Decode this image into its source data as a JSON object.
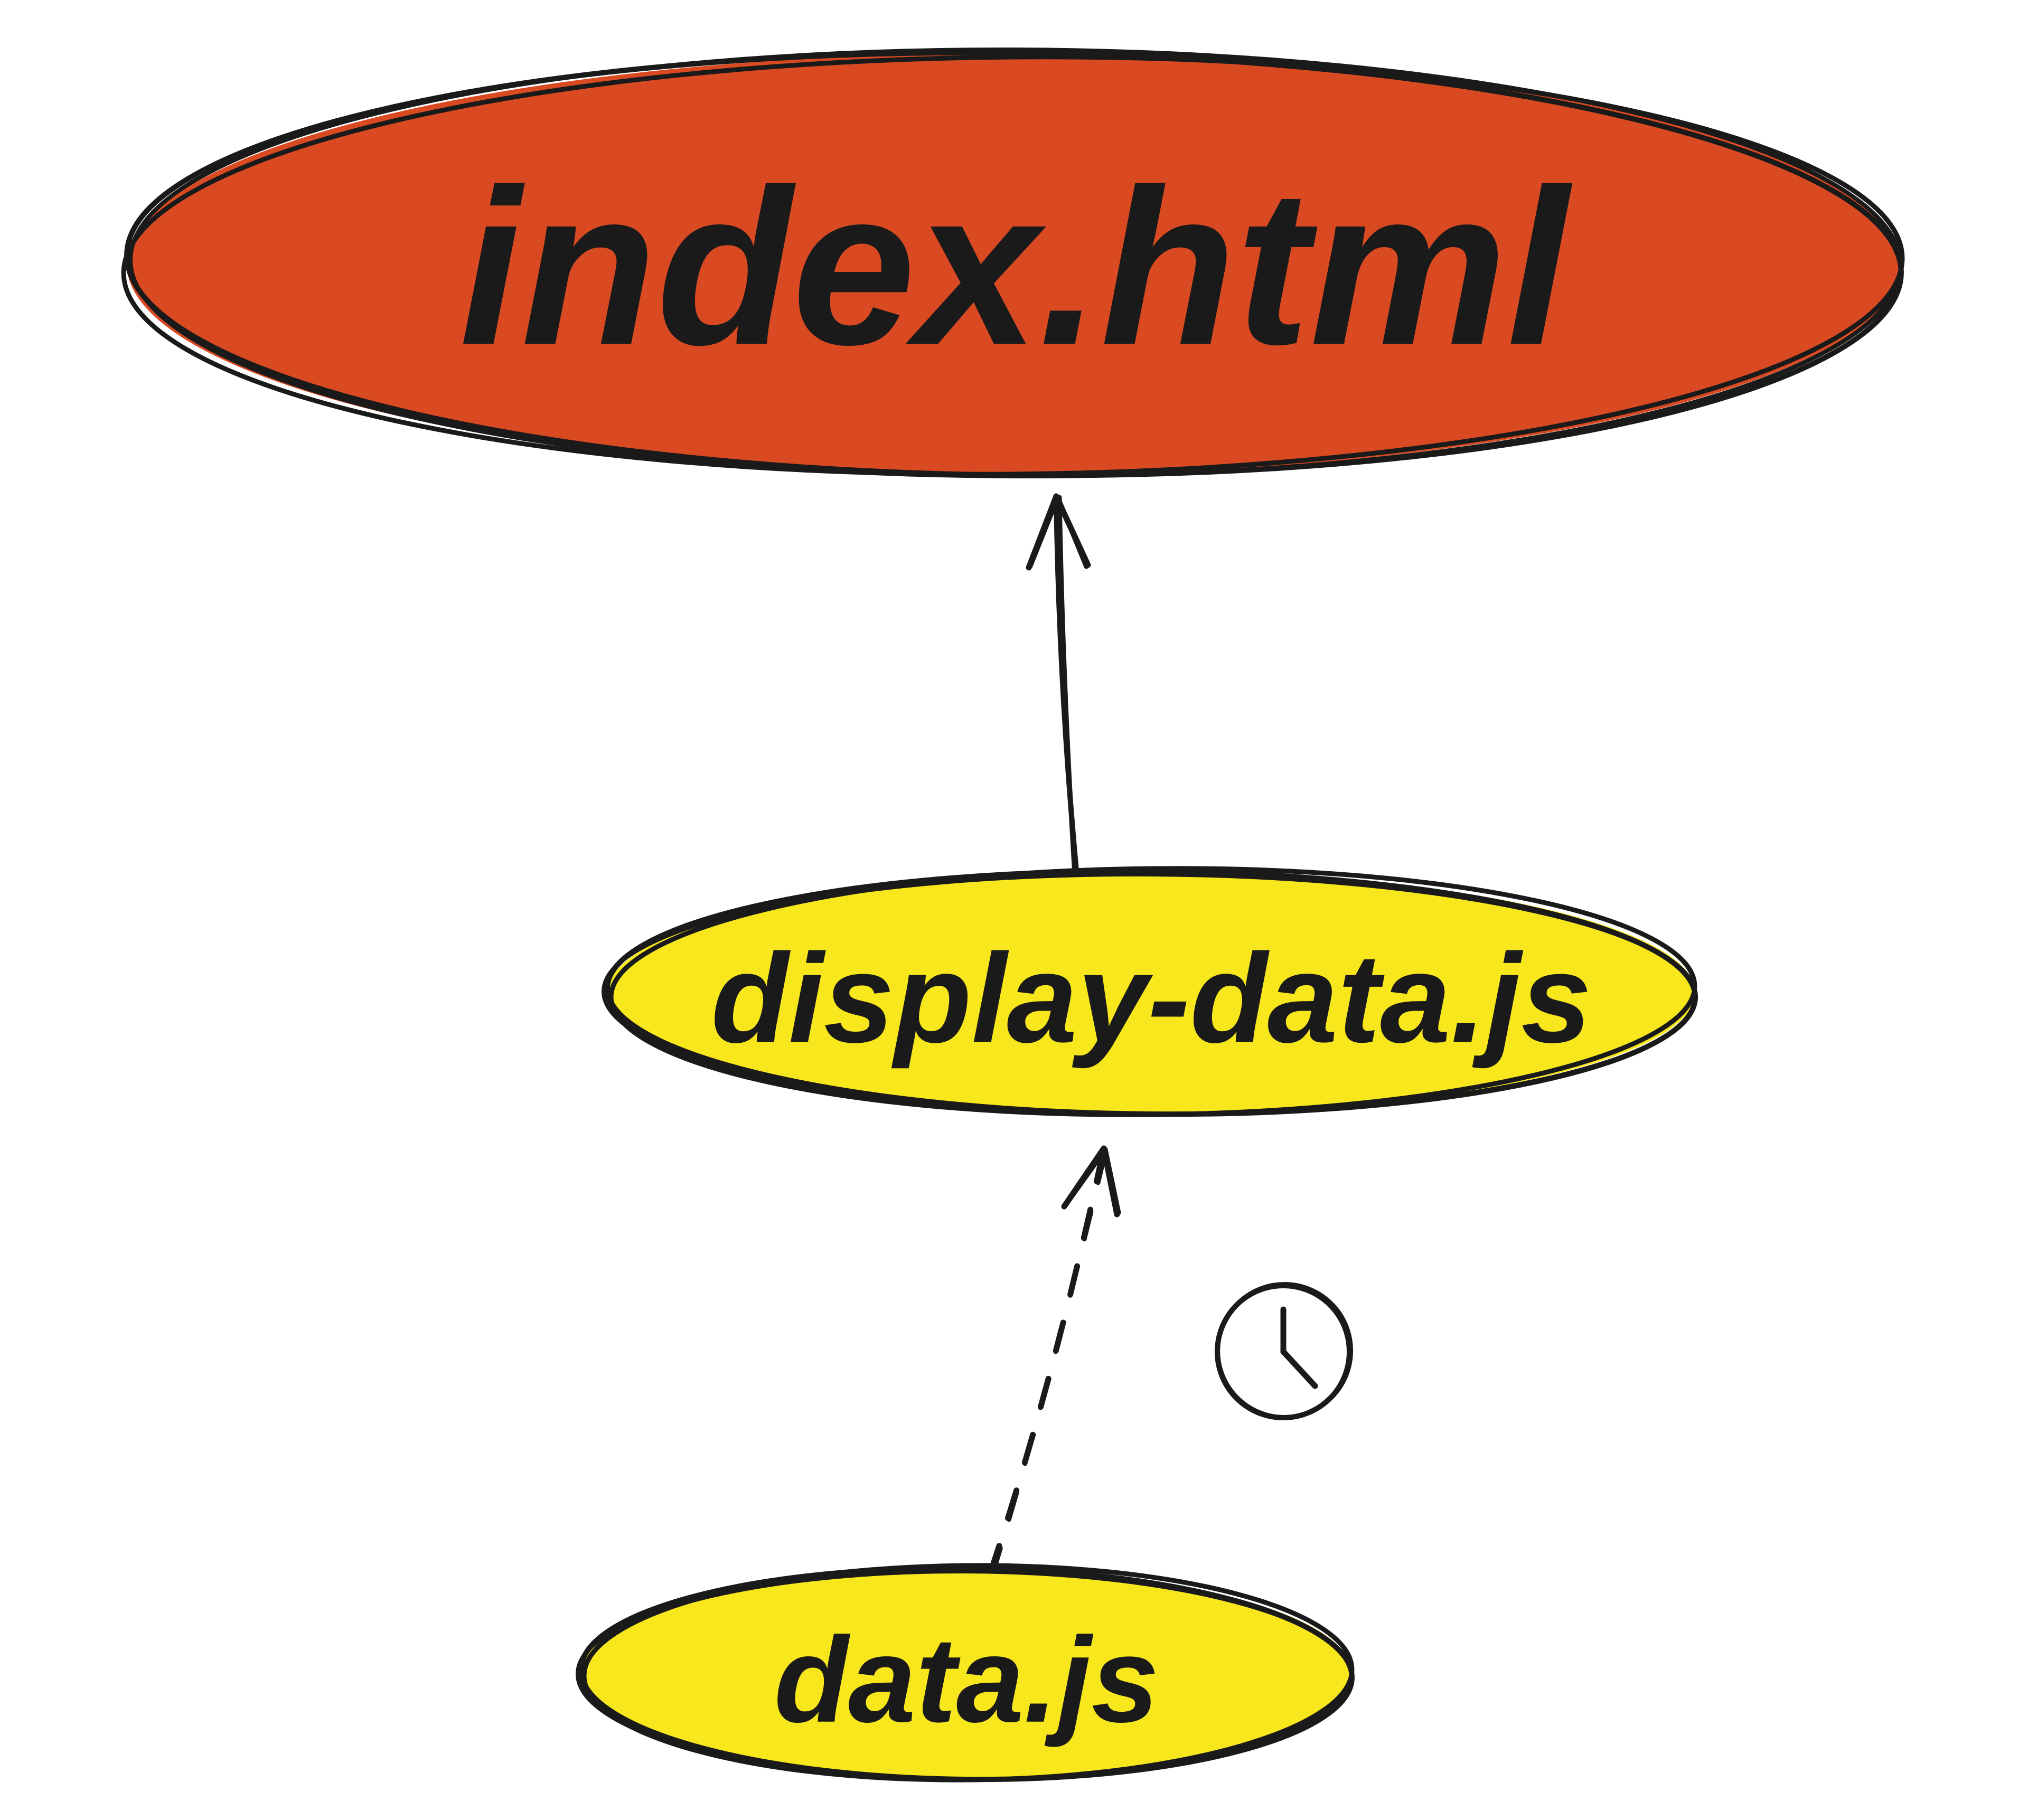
{
  "diagram": {
    "nodes": {
      "root": {
        "label": "index.html",
        "color": "#d94a22"
      },
      "middle": {
        "label": "display-data.js",
        "color": "#f8e71c"
      },
      "bottom": {
        "label": "data.js",
        "color": "#f8e71c"
      }
    },
    "edges": {
      "middle_to_root": {
        "style": "solid",
        "direction": "up"
      },
      "bottom_to_middle": {
        "style": "dashed",
        "direction": "up",
        "annotation": "clock-icon"
      }
    }
  }
}
